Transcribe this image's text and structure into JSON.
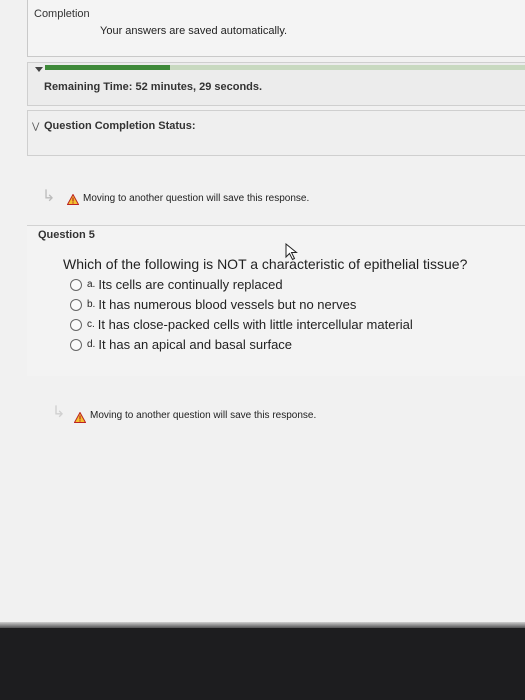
{
  "header": {
    "completion_label": "Completion",
    "saved_message": "Your answers are saved automatically."
  },
  "timer": {
    "label": "Remaining Time:",
    "value": "52 minutes, 29 seconds.",
    "progress_fraction": 0.26,
    "progress_color": "#3f8a3a"
  },
  "completion_status": {
    "label": "Question Completion Status:"
  },
  "warning_top": {
    "text": "Moving to another question will save this response."
  },
  "question": {
    "number": "Question 5",
    "text": "Which of the following is NOT a characteristic of epithelial tissue?",
    "options": [
      {
        "letter": "a.",
        "text": "Its cells are continually replaced"
      },
      {
        "letter": "b.",
        "text": "It has numerous blood vessels but no nerves"
      },
      {
        "letter": "c.",
        "text": "It has close-packed cells with little intercellular material"
      },
      {
        "letter": "d.",
        "text": "It has an apical and basal surface"
      }
    ]
  },
  "warning_bottom": {
    "text": "Moving to another question will save this response."
  },
  "icons": {
    "warning": "warning-triangle-icon",
    "nav": "nav-arrow-icon",
    "cursor": "mouse-cursor-icon"
  }
}
